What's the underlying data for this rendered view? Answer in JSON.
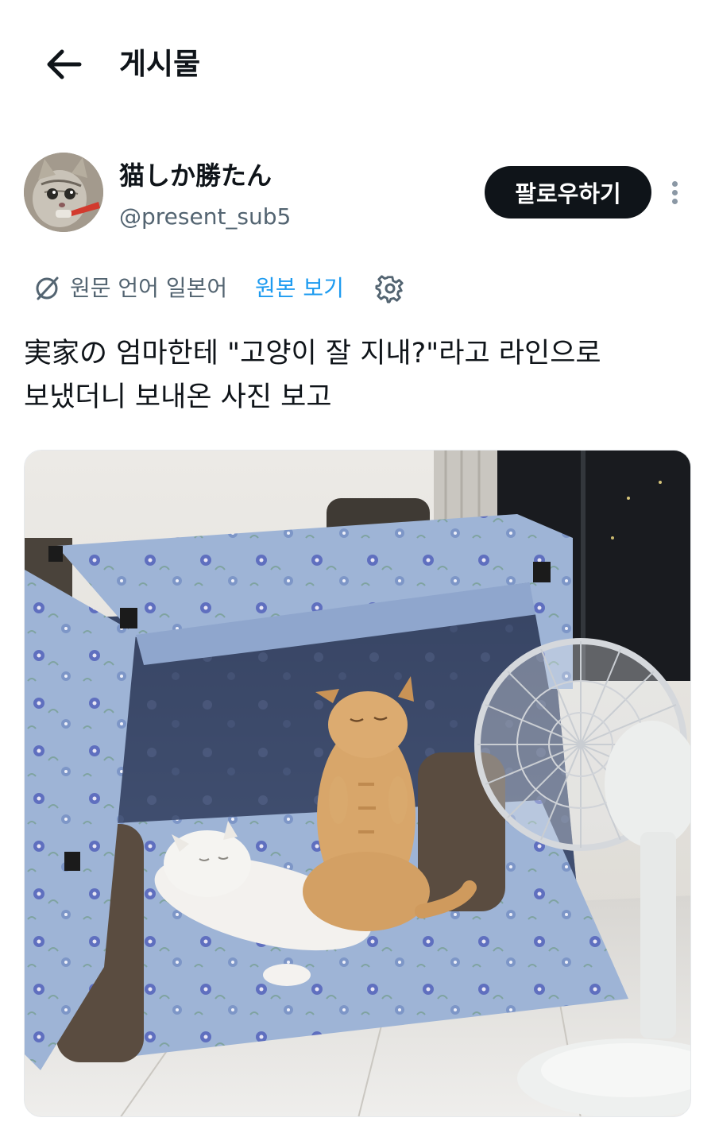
{
  "header": {
    "title": "게시물"
  },
  "author": {
    "display_name": "猫しか勝たん",
    "handle": "@present_sub5"
  },
  "follow_button": {
    "label": "팔로우하기"
  },
  "translation": {
    "source_text": "원문 언어 일본어",
    "link_label": "원본 보기"
  },
  "post": {
    "text": "実家の 엄마한테 \"고양이 잘 지내?\"라고 라인으로\n보냈더니 보내온 사진 보고"
  },
  "icons": {
    "back": "arrow-left-icon",
    "more": "more-vertical-icon",
    "translate": "translate-icon",
    "settings": "gear-icon"
  },
  "colors": {
    "text": "#0f1419",
    "secondary_text": "#536471",
    "link": "#1d9bf0",
    "button_bg": "#0f1419",
    "button_text": "#ffffff"
  }
}
